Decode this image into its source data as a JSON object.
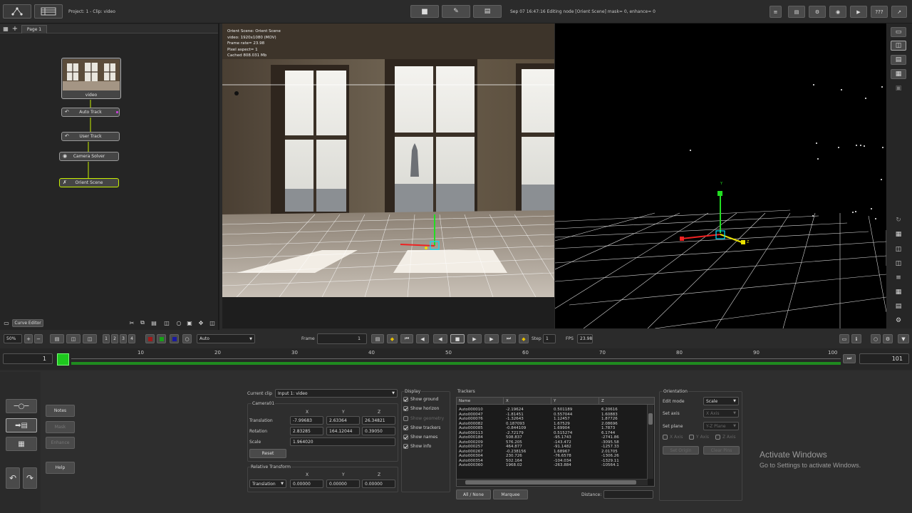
{
  "header": {
    "project_label": "Project: 1 - Clip: video",
    "status": "Sep 07 16:47:16 Editing node [Orient Scene] mask= 0, enhance= 0",
    "help_label": "???"
  },
  "node_panel": {
    "page_tab": "Page 1",
    "curve_editor_label": "Curve Editor",
    "nodes": {
      "video": "video",
      "auto_track": "Auto Track",
      "user_track": "User Track",
      "camera_solver": "Camera Solver",
      "orient_scene": "Orient Scene"
    }
  },
  "viewer": {
    "info": [
      "Orient Scene: Orient Scene",
      "video: 1920x1080 (MOV)",
      "Frame rate= 23.98",
      "Pixel aspect= 1",
      "Cached 808.031 Mb"
    ],
    "axis_y": "Y",
    "axis_z": "Z"
  },
  "playback": {
    "zoom": "50%",
    "channel_1": "1",
    "channel_2": "2",
    "channel_3": "3",
    "channel_4": "4",
    "dropdown": "Auto",
    "frame_label": "Frame",
    "frame_value": "1",
    "step_label": "Step",
    "step_value": "1",
    "fps_label": "FPS",
    "fps_value": "23.98"
  },
  "timeline": {
    "start": "1",
    "end": "101",
    "ticks": [
      "10",
      "20",
      "30",
      "40",
      "50",
      "60",
      "70",
      "80",
      "90",
      "100"
    ]
  },
  "left_buttons": {
    "notes": "Notes",
    "mask": "Mask",
    "enhance": "Enhance",
    "help": "Help"
  },
  "clip_panel": {
    "current_clip_label": "Current clip",
    "current_clip_value": "Input 1: video",
    "camera_name": "Camera01",
    "x_label": "X",
    "y_label": "Y",
    "z_label": "Z",
    "translation_label": "Translation",
    "translation": [
      "-7.99683",
      "2.63364",
      "26.34821"
    ],
    "rotation_label": "Rotation",
    "rotation": [
      "2.83285",
      "164.12044",
      "0.39050"
    ],
    "scale_label": "Scale",
    "scale": "1.964020",
    "reset_label": "Reset",
    "relative_label": "Relative Transform",
    "relative_mode": "Translation",
    "relative": [
      "0.00000",
      "0.00000",
      "0.00000"
    ]
  },
  "display_panel": {
    "title": "Display",
    "items": [
      {
        "label": "Show ground",
        "checked": true
      },
      {
        "label": "Show horizon",
        "checked": true
      },
      {
        "label": "Show geometry",
        "checked": false
      },
      {
        "label": "Show trackers",
        "checked": true
      },
      {
        "label": "Show names",
        "checked": true
      },
      {
        "label": "Show info",
        "checked": true
      }
    ]
  },
  "trackers_panel": {
    "title": "Trackers",
    "columns": [
      "Name",
      "X",
      "Y",
      "Z"
    ],
    "rows": [
      [
        "Auto000010",
        "-2.19624",
        "0.501189",
        "6.20616"
      ],
      [
        "Auto000047",
        "-1.81451",
        "0.557044",
        "1.60883"
      ],
      [
        "Auto000076",
        "-1.32643",
        "1.12457",
        "1.87726"
      ],
      [
        "Auto000082",
        "0.187093",
        "1.67529",
        "2.08696"
      ],
      [
        "Auto000085",
        "-0.844109",
        "1.69904",
        "1.7873"
      ],
      [
        "Auto000113",
        "-2.72179",
        "0.515274",
        "6.1744"
      ],
      [
        "Auto000184",
        "508.837",
        "-95.1743",
        "-2741.86"
      ],
      [
        "Auto000209",
        "576.205",
        "-143.472",
        "-3095.58"
      ],
      [
        "Auto000257",
        "464.877",
        "-91.1482",
        "-1257.33"
      ],
      [
        "Auto000267",
        "-0.238156",
        "1.68967",
        "2.01705"
      ],
      [
        "Auto000304",
        "230.726",
        "-76.6578",
        "-1306.26"
      ],
      [
        "Auto000354",
        "502.164",
        "-104.034",
        "-1329.11"
      ],
      [
        "Auto000360",
        "1968.02",
        "-263.884",
        "-10564.1"
      ]
    ],
    "all_none_label": "All / None",
    "marquee_label": "Marquee",
    "distance_label": "Distance:"
  },
  "orientation_panel": {
    "title": "Orientation",
    "edit_mode_label": "Edit mode",
    "edit_mode_value": "Scale",
    "set_axis_label": "Set axis",
    "set_axis_value": "X Axis",
    "set_plane_label": "Set plane",
    "set_plane_value": "Y-Z Plane",
    "x_axis": "X Axis",
    "y_axis": "Y Axis",
    "z_axis": "Z Axis",
    "set_origin": "Set Origin",
    "clear_pins": "Clear Pins"
  },
  "watermark": {
    "title": "Activate Windows",
    "subtitle": "Go to Settings to activate Windows."
  }
}
